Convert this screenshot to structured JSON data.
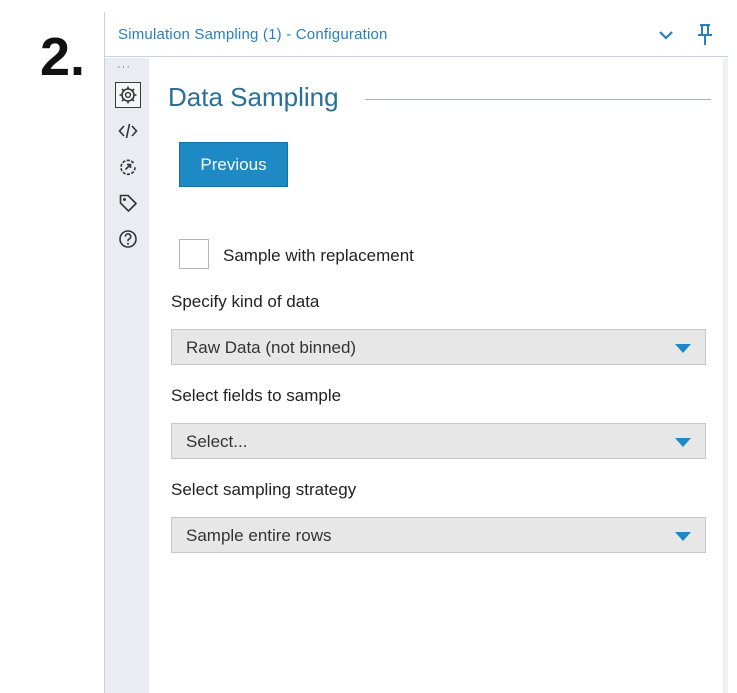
{
  "step_label": "2.",
  "header": {
    "title": "Simulation Sampling (1) - Configuration",
    "icons": [
      "chevron-down-icon",
      "pin-icon"
    ]
  },
  "sidebar": {
    "more": "···",
    "items": [
      {
        "icon": "gear-icon",
        "active": true
      },
      {
        "icon": "code-icon",
        "active": false
      },
      {
        "icon": "connection-icon",
        "active": false
      },
      {
        "icon": "tag-icon",
        "active": false
      },
      {
        "icon": "help-icon",
        "active": false
      }
    ]
  },
  "main": {
    "section_title": "Data Sampling",
    "previous_button": "Previous",
    "checkbox_label": "Sample with replacement",
    "fields": [
      {
        "label": "Specify kind of data",
        "value": "Raw Data (not binned)"
      },
      {
        "label": "Select fields to sample",
        "value": "Select..."
      },
      {
        "label": "Select sampling strategy",
        "value": "Sample entire rows"
      }
    ]
  },
  "colors": {
    "accent": "#1d8ac6",
    "header_text": "#2a7fb8",
    "title_text": "#2a6f9a",
    "dropdown_bg": "#e7e7e7",
    "sidebar_bg": "#e9ecf0"
  }
}
